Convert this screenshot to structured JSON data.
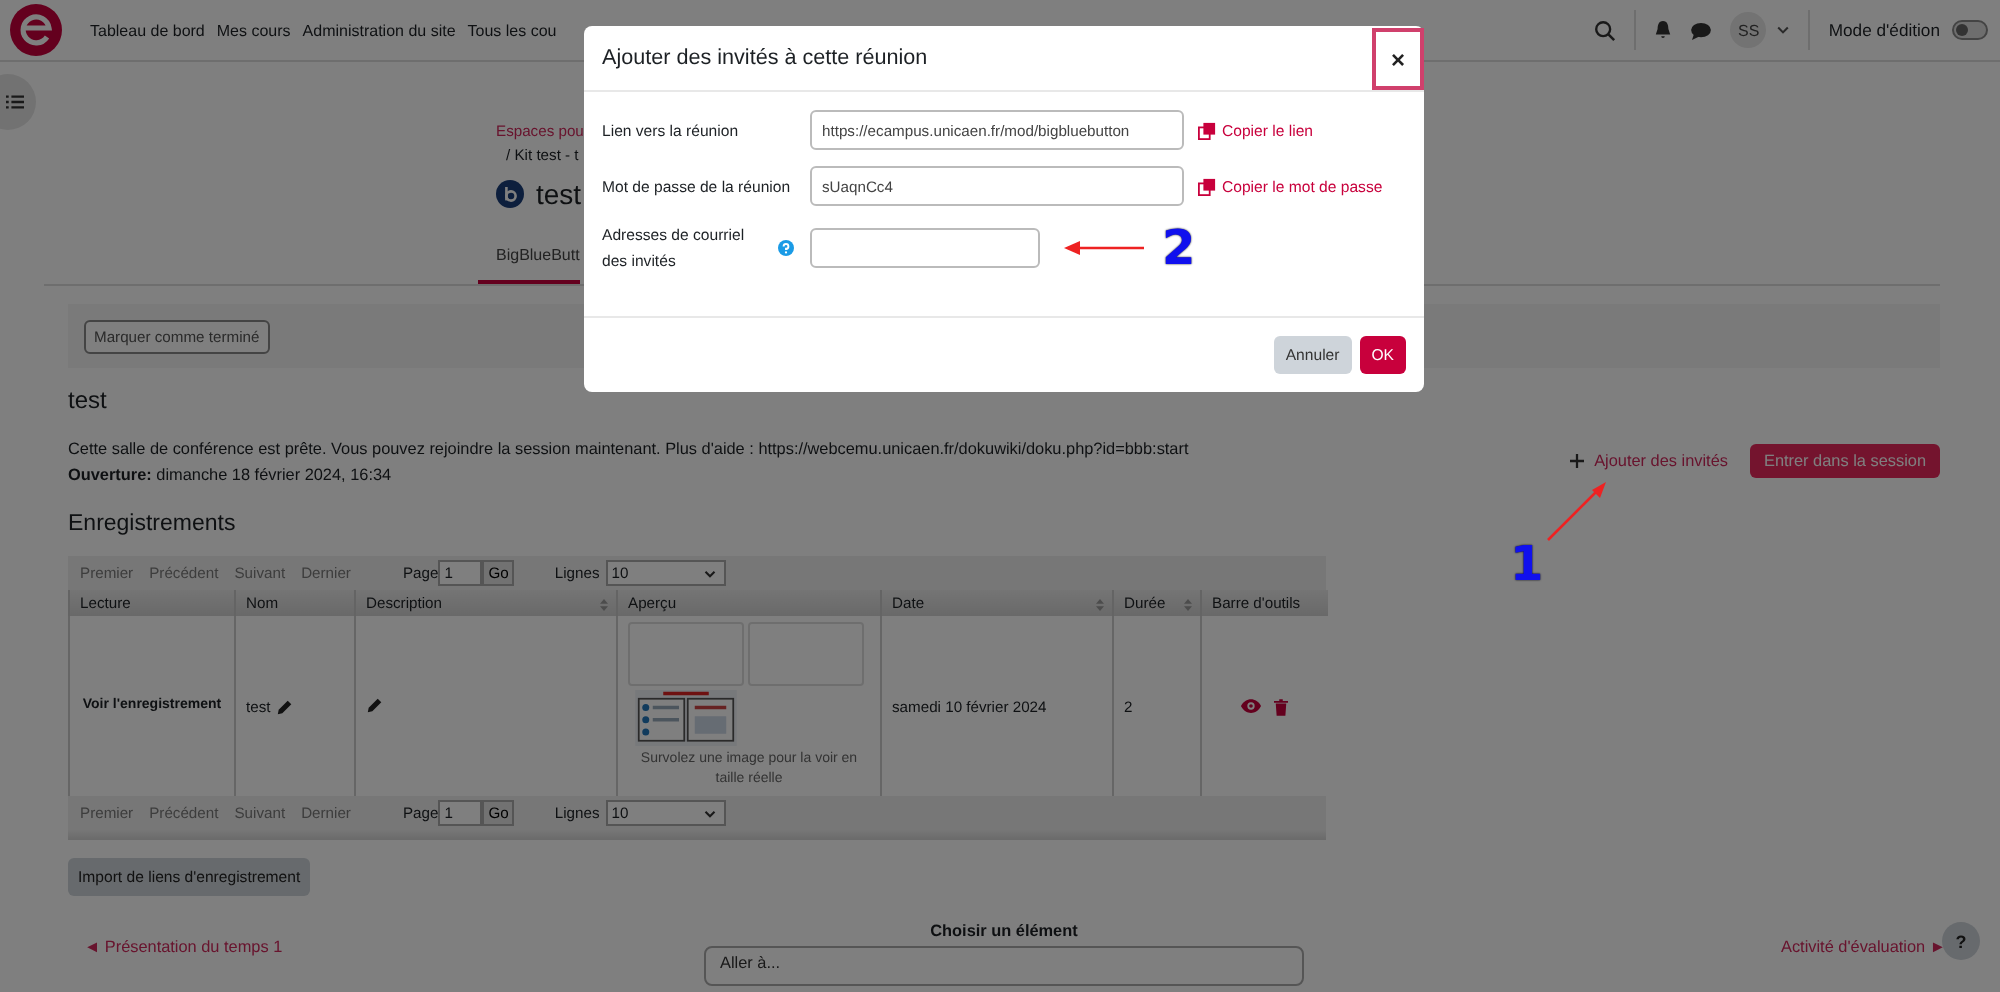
{
  "navbar": {
    "links": [
      "Tableau de bord",
      "Mes cours",
      "Administration du site",
      "Tous les cou"
    ],
    "avatar": "SS",
    "edit_mode": {
      "label": "Mode d'édition",
      "on": false
    }
  },
  "header": {
    "breadcrumb": [
      "Espaces pou",
      "/ Kit test - t"
    ],
    "title": "test",
    "tabs": [
      {
        "label": "BigBlueButt",
        "selected": true
      }
    ]
  },
  "completion_button": "Marquer comme terminé",
  "room": {
    "title": "test",
    "description": "Cette salle de conférence est prête. Vous pouvez rejoindre la session maintenant. Plus d'aide : https://webcemu.unicaen.fr/dokuwiki/doku.php?id=bbb:start",
    "opening_label": "Ouverture:",
    "opening_value": "dimanche 18 février 2024, 16:34",
    "add_guests": "Ajouter des invités",
    "join_button": "Entrer dans la session"
  },
  "recordings": {
    "title": "Enregistrements",
    "pagers": [
      {
        "links": [
          {
            "label": "Premier",
            "disabled": true
          },
          {
            "label": "Précédent",
            "disabled": true
          },
          {
            "label": "Suivant",
            "disabled": true
          },
          {
            "label": "Dernier",
            "disabled": true
          }
        ],
        "page_label": "Page",
        "page": "1",
        "go": "Go",
        "rows_label": "Lignes",
        "rows": "10"
      },
      {
        "links": [
          {
            "label": "Premier",
            "disabled": true
          },
          {
            "label": "Précédent",
            "disabled": true
          },
          {
            "label": "Suivant",
            "disabled": true
          },
          {
            "label": "Dernier",
            "disabled": true
          }
        ],
        "page_label": "Page",
        "page": "1",
        "go": "Go",
        "rows_label": "Lignes",
        "rows": "10"
      }
    ],
    "columns": [
      {
        "label": "Lecture",
        "sortable": false
      },
      {
        "label": "Nom",
        "sortable": false
      },
      {
        "label": "Description",
        "sortable": true
      },
      {
        "label": "Aperçu",
        "sortable": false
      },
      {
        "label": "Date",
        "sortable": true
      },
      {
        "label": "Durée",
        "sortable": true
      },
      {
        "label": "Barre d'outils",
        "sortable": false
      }
    ],
    "rows": [
      {
        "playback": "Voir l'enregistrement",
        "name": "test",
        "thumbnails": [
          {
            "kind": "empty"
          },
          {
            "kind": "empty"
          },
          {
            "kind": "picture"
          }
        ],
        "preview_hint": "Survolez une image pour la voir en taille réelle",
        "date": "samedi 10 février 2024",
        "duration": "2"
      }
    ],
    "import_button": "Import de liens d'enregistrement"
  },
  "footer": {
    "previous": "◄ Présentation du temps 1",
    "jump_label": "Choisir un élément",
    "jump_placeholder": "Aller à...",
    "next": "Activité d'évaluation ►"
  },
  "help_button": "?",
  "dialog": {
    "title": "Ajouter des invités à cette réunion",
    "close": "×",
    "fields": [
      {
        "label": "Lien vers la réunion",
        "value": "https://ecampus.unicaen.fr/mod/bigbluebutton",
        "action": "Copier le lien"
      },
      {
        "label": "Mot de passe de la réunion",
        "value": "sUaqnCc4",
        "action": "Copier le mot de passe"
      },
      {
        "label": "Adresses de courriel des invités",
        "help": true
      }
    ],
    "buttons": [
      {
        "label": "Annuler",
        "kind": "secondary"
      },
      {
        "label": "OK",
        "kind": "primary"
      }
    ]
  },
  "annotations": [
    {
      "label": "1"
    },
    {
      "label": "2"
    }
  ]
}
